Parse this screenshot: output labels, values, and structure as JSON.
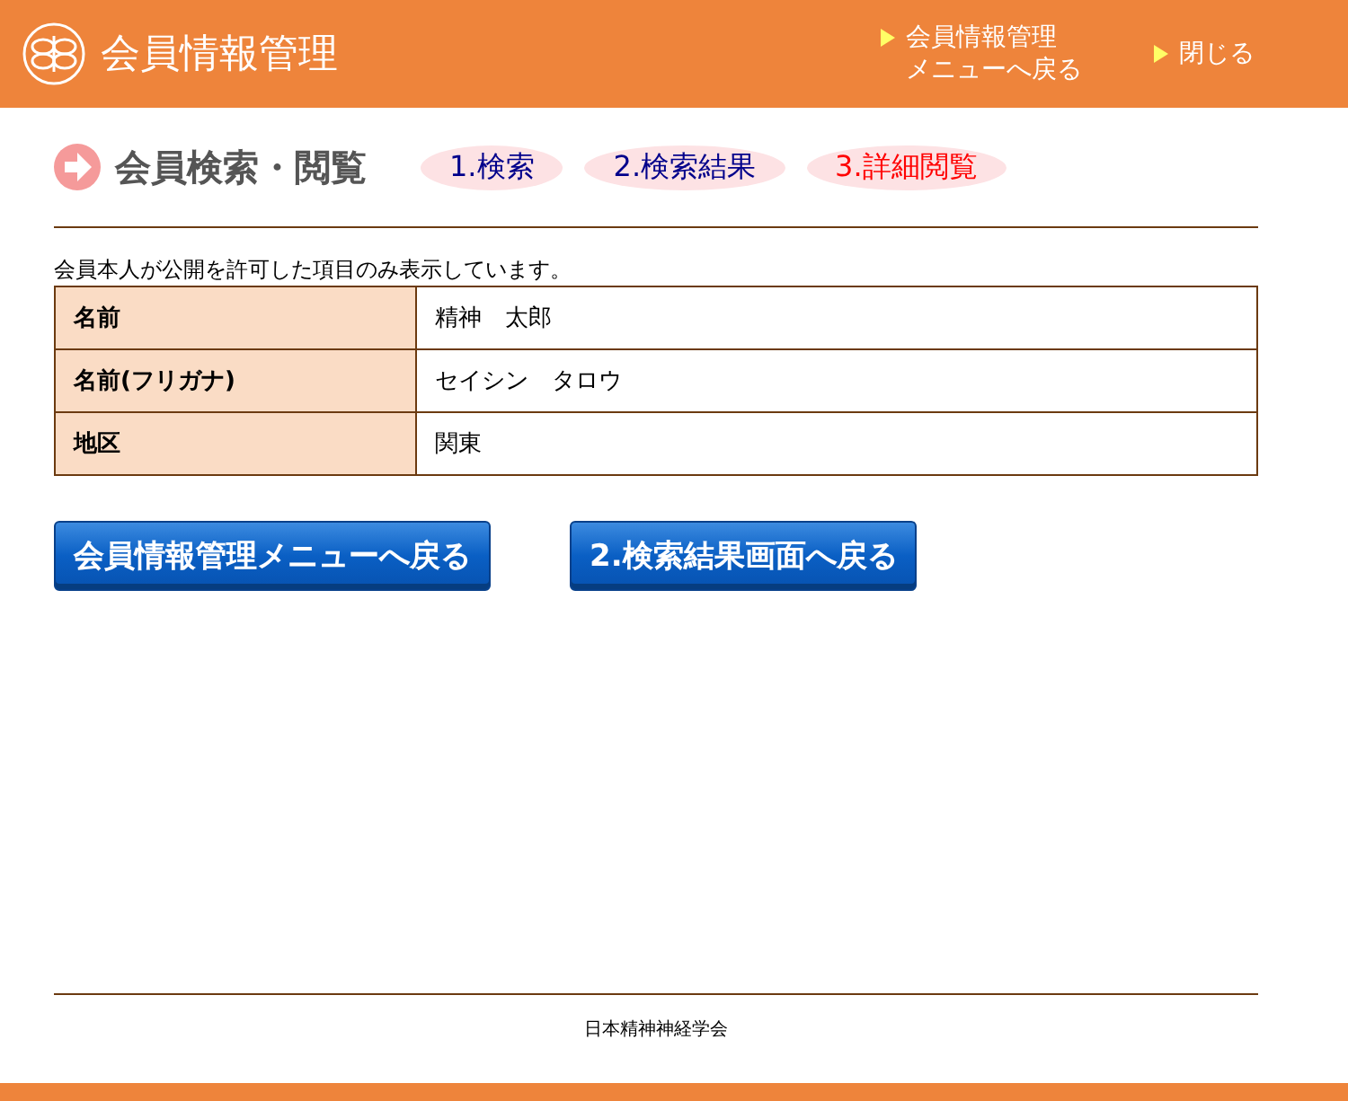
{
  "header": {
    "title": "会員情報管理",
    "links": [
      {
        "lines": [
          "会員情報管理",
          "メニューへ戻る"
        ]
      },
      {
        "lines": [
          "閉じる"
        ]
      }
    ]
  },
  "page_title": "会員検索・閲覧",
  "steps": [
    {
      "label": "1.検索",
      "selected": false
    },
    {
      "label": "2.検索結果",
      "selected": false
    },
    {
      "label": "3.詳細閲覧",
      "selected": true
    }
  ],
  "note": "会員本人が公開を許可した項目のみ表示しています。",
  "table": {
    "rows": [
      {
        "label": "名前",
        "value": "精神　太郎"
      },
      {
        "label": "名前(フリガナ)",
        "value": "セイシン　タロウ"
      },
      {
        "label": "地区",
        "value": "関東"
      }
    ]
  },
  "buttons": [
    "会員情報管理メニューへ戻る",
    "2.検索結果画面へ戻る"
  ],
  "footer": "日本精神神経学会"
}
